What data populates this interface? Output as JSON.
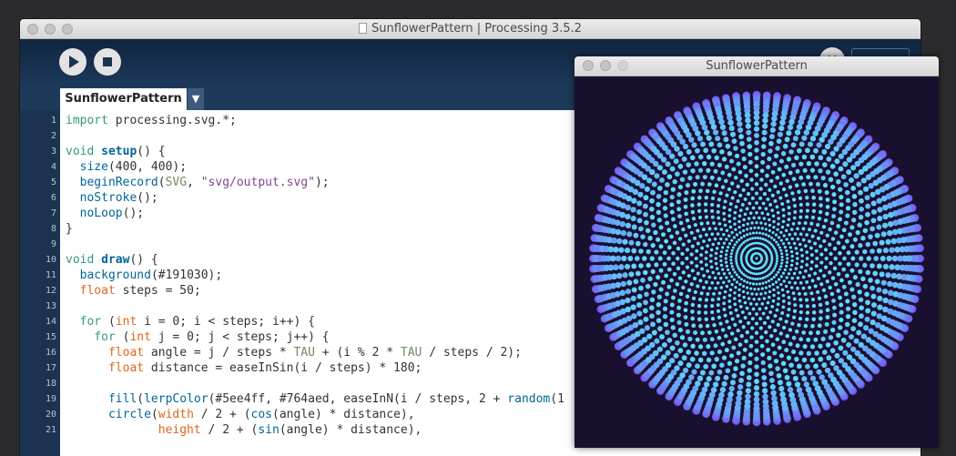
{
  "ide": {
    "title": "SunflowerPattern | Processing 3.5.2",
    "tab_label": "SunflowerPattern",
    "tab_menu_glyph": "▼",
    "mode_glyph": "✕",
    "run_icon": "play-icon",
    "stop_icon": "stop-icon",
    "line_numbers": [
      "1",
      "2",
      "3",
      "4",
      "5",
      "6",
      "7",
      "8",
      "9",
      "10",
      "11",
      "12",
      "13",
      "14",
      "15",
      "16",
      "17",
      "18",
      "19",
      "20",
      "21"
    ],
    "code": [
      [
        [
          "k",
          "import"
        ],
        [
          "p",
          " processing.svg.*;"
        ]
      ],
      [],
      [
        [
          "k",
          "void"
        ],
        [
          "p",
          " "
        ],
        [
          "fnb",
          "setup"
        ],
        [
          "p",
          "() {"
        ]
      ],
      [
        [
          "p",
          "  "
        ],
        [
          "fn",
          "size"
        ],
        [
          "p",
          "(400, 400);"
        ]
      ],
      [
        [
          "p",
          "  "
        ],
        [
          "fn",
          "beginRecord"
        ],
        [
          "p",
          "("
        ],
        [
          "cn",
          "SVG"
        ],
        [
          "p",
          ", "
        ],
        [
          "st",
          "\"svg/output.svg\""
        ],
        [
          "p",
          ");"
        ]
      ],
      [
        [
          "p",
          "  "
        ],
        [
          "fn",
          "noStroke"
        ],
        [
          "p",
          "();"
        ]
      ],
      [
        [
          "p",
          "  "
        ],
        [
          "fn",
          "noLoop"
        ],
        [
          "p",
          "();"
        ]
      ],
      [
        [
          "p",
          "}"
        ]
      ],
      [],
      [
        [
          "k",
          "void"
        ],
        [
          "p",
          " "
        ],
        [
          "fnb",
          "draw"
        ],
        [
          "p",
          "() {"
        ]
      ],
      [
        [
          "p",
          "  "
        ],
        [
          "fn",
          "background"
        ],
        [
          "p",
          "(#191030);"
        ]
      ],
      [
        [
          "p",
          "  "
        ],
        [
          "kw",
          "float"
        ],
        [
          "p",
          " steps = 50;"
        ]
      ],
      [],
      [
        [
          "p",
          "  "
        ],
        [
          "k",
          "for"
        ],
        [
          "p",
          " ("
        ],
        [
          "kw",
          "int"
        ],
        [
          "p",
          " i = 0; i < steps; i++) {"
        ]
      ],
      [
        [
          "p",
          "    "
        ],
        [
          "k",
          "for"
        ],
        [
          "p",
          " ("
        ],
        [
          "kw",
          "int"
        ],
        [
          "p",
          " j = 0; j < steps; j++) {"
        ]
      ],
      [
        [
          "p",
          "      "
        ],
        [
          "kw",
          "float"
        ],
        [
          "p",
          " angle = j / steps * "
        ],
        [
          "cn",
          "TAU"
        ],
        [
          "p",
          " + (i % 2 * "
        ],
        [
          "cn",
          "TAU"
        ],
        [
          "p",
          " / steps / 2);"
        ]
      ],
      [
        [
          "p",
          "      "
        ],
        [
          "kw",
          "float"
        ],
        [
          "p",
          " distance = easeInSin(i / steps) * 180;"
        ]
      ],
      [],
      [
        [
          "p",
          "      "
        ],
        [
          "fn",
          "fill"
        ],
        [
          "p",
          "("
        ],
        [
          "fn",
          "lerpColor"
        ],
        [
          "p",
          "(#5ee4ff, #764aed, easeInN(i / steps, 2 + "
        ],
        [
          "fn",
          "random"
        ],
        [
          "p",
          "(1"
        ]
      ],
      [
        [
          "p",
          "      "
        ],
        [
          "fn",
          "circle"
        ],
        [
          "p",
          "("
        ],
        [
          "kw",
          "width"
        ],
        [
          "p",
          " / 2 + ("
        ],
        [
          "fn",
          "cos"
        ],
        [
          "p",
          "(angle) * distance),"
        ]
      ],
      [
        [
          "p",
          "             "
        ],
        [
          "kw",
          "height"
        ],
        [
          "p",
          " / 2 + ("
        ],
        [
          "fn",
          "sin"
        ],
        [
          "p",
          "(angle) * distance),"
        ]
      ]
    ]
  },
  "sketch": {
    "title": "SunflowerPattern",
    "background": "#191030",
    "color_center": "#5ee4ff",
    "color_edge": "#764aed",
    "steps": 50,
    "max_distance": 180
  }
}
